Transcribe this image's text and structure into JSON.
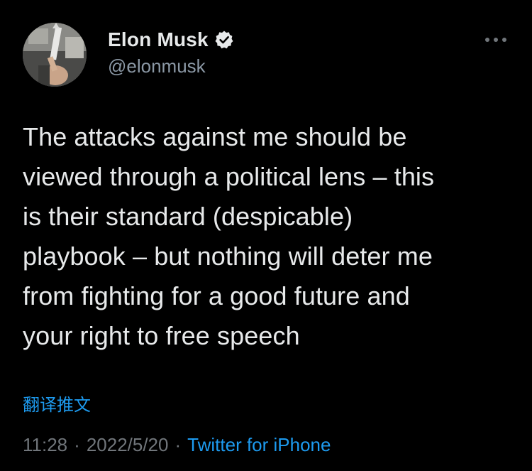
{
  "author": {
    "display_name": "Elon Musk",
    "handle": "@elonmusk",
    "verified": true,
    "avatar_icon": "profile-photo"
  },
  "more_icon": "more-options-icon",
  "tweet": {
    "text": "The attacks against me should be\nviewed through a political lens – this\nis their standard (despicable)\nplaybook – but nothing will deter me\nfrom fighting for a good future and\nyour right to free speech",
    "translate_label": "翻译推文",
    "time": "11:28",
    "separator": "·",
    "date": "2022/5/20",
    "source": "Twitter for iPhone"
  },
  "colors": {
    "background": "#000000",
    "text": "#e7e9ea",
    "secondary": "#71767b",
    "accent": "#1d9bf0"
  }
}
